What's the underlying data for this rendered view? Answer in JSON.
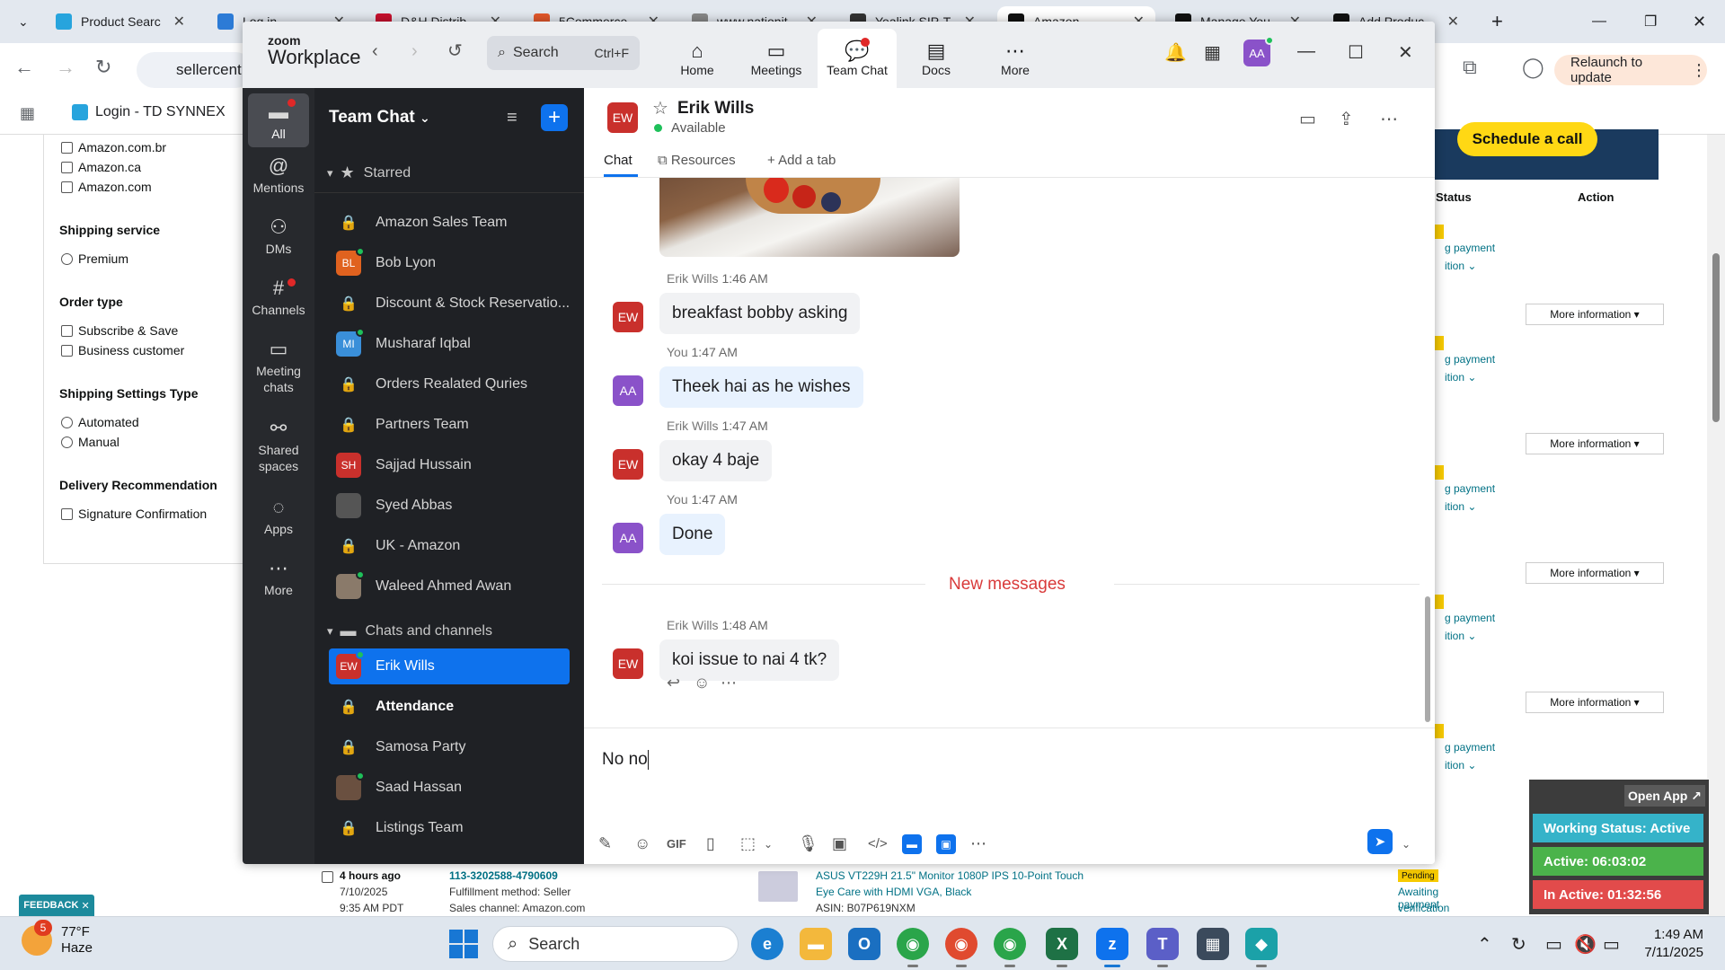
{
  "browser": {
    "tabs": [
      {
        "label": "Product Searc",
        "active": false
      },
      {
        "label": "Log in",
        "active": false
      },
      {
        "label": "D&H Distrib",
        "active": false
      },
      {
        "label": "5Commerce",
        "active": false
      },
      {
        "label": "www.nationit",
        "active": false
      },
      {
        "label": "Yealink SIP-T",
        "active": false
      },
      {
        "label": "Amazon",
        "active": true
      },
      {
        "label": "Manage You",
        "active": false
      },
      {
        "label": "Add Produc",
        "active": false
      }
    ],
    "address": "sellercent",
    "relaunch_label": "Relaunch to update",
    "bookmark_label": "Login - TD SYNNEX"
  },
  "page": {
    "filters": {
      "marketplaces": [
        "Amazon.com.br",
        "Amazon.ca",
        "Amazon.com"
      ],
      "shipping_service_heading": "Shipping service",
      "shipping_service_options": [
        "Premium"
      ],
      "order_type_heading": "Order type",
      "order_type_options": [
        "Subscribe & Save",
        "Business customer"
      ],
      "shipping_settings_heading": "Shipping Settings Type",
      "shipping_settings_options": [
        "Automated",
        "Manual"
      ],
      "delivery_heading": "Delivery Recommendation",
      "delivery_options": [
        "Signature Confirmation"
      ]
    },
    "schedule_button": "Schedule a call",
    "col_status": "Status",
    "col_action": "Action",
    "awaiting_text": "g payment",
    "verification_text": "ition",
    "more_info": "More information",
    "order": {
      "age": "4 hours ago",
      "date": "7/10/2025",
      "time": "9:35 AM PDT",
      "order_id": "113-3202588-4790609",
      "fulfillment": "Fulfillment method: Seller",
      "channel": "Sales channel: Amazon.com",
      "product_line1": "ASUS VT229H 21.5\" Monitor 1080P IPS 10-Point Touch",
      "product_line2": "Eye Care with HDMI VGA, Black",
      "asin": "ASIN: B07P619NXM",
      "status_badge": "Pending",
      "status_line1": "Awaiting payment",
      "status_line2": "verification"
    },
    "feedback_label": "FEEDBACK"
  },
  "widget": {
    "open_app": "Open App",
    "working_status": "Working Status: Active",
    "active_time": "Active: 06:03:02",
    "inactive_time": "In Active: 01:32:56",
    "colors": {
      "status": "#35b3c9",
      "active": "#4bb34b",
      "inactive": "#e24b4b"
    }
  },
  "zoom": {
    "brand_top": "zoom",
    "brand_bottom": "Workplace",
    "search_label": "Search",
    "search_shortcut": "Ctrl+F",
    "nav": [
      {
        "label": "Home",
        "icon": "home-icon"
      },
      {
        "label": "Meetings",
        "icon": "video-icon"
      },
      {
        "label": "Team Chat",
        "icon": "chat-icon",
        "selected": true
      },
      {
        "label": "Docs",
        "icon": "docs-icon"
      },
      {
        "label": "More",
        "icon": "more-icon"
      }
    ],
    "user_initials": "AA",
    "rail": [
      {
        "label": "All",
        "selected": true
      },
      {
        "label": "Mentions"
      },
      {
        "label": "DMs"
      },
      {
        "label": "Channels"
      },
      {
        "label": "Meeting chats"
      },
      {
        "label": "Shared spaces"
      },
      {
        "label": "Apps"
      },
      {
        "label": "More"
      }
    ],
    "list_title": "Team Chat",
    "starred_label": "Starred",
    "starred": [
      {
        "name": "Amazon Sales Team",
        "type": "lock"
      },
      {
        "name": "Bob Lyon",
        "type": "avatar",
        "initials": "BL",
        "color": "#e0621f",
        "online": true
      },
      {
        "name": "Discount & Stock Reservatio...",
        "type": "lock"
      },
      {
        "name": "Musharaf Iqbal",
        "type": "avatar",
        "initials": "MI",
        "color": "#3a8fd9",
        "online": true
      },
      {
        "name": "Orders Realated Quries",
        "type": "lock"
      },
      {
        "name": "Partners Team",
        "type": "lock"
      },
      {
        "name": "Sajjad Hussain",
        "type": "avatar",
        "initials": "SH",
        "color": "#c9302c",
        "online": false
      },
      {
        "name": "Syed Abbas",
        "type": "photo",
        "color": "#555555",
        "online": false
      },
      {
        "name": "UK - Amazon",
        "type": "lock"
      },
      {
        "name": "Waleed Ahmed Awan",
        "type": "photo",
        "color": "#8a7a6a",
        "online": true
      }
    ],
    "chats_label": "Chats and channels",
    "chats": [
      {
        "name": "Erik Wills",
        "type": "avatar",
        "initials": "EW",
        "color": "#c9302c",
        "online": true,
        "selected": true
      },
      {
        "name": "Attendance",
        "type": "lock",
        "bold": true
      },
      {
        "name": "Samosa Party",
        "type": "lock"
      },
      {
        "name": "Saad Hassan",
        "type": "photo",
        "color": "#6a5040",
        "online": true
      },
      {
        "name": "Listings Team",
        "type": "lock"
      }
    ],
    "conversation": {
      "initials": "EW",
      "name": "Erik Wills",
      "status": "Available",
      "tabs": [
        "Chat",
        "Resources",
        "Add a tab"
      ],
      "messages": [
        {
          "sender": "Erik Wills",
          "time": "1:46 AM",
          "text": "breakfast bobby asking",
          "initials": "EW",
          "mine": false
        },
        {
          "sender": "You",
          "time": "1:47 AM",
          "text": "Theek hai as he wishes",
          "initials": "AA",
          "mine": true
        },
        {
          "sender": "Erik Wills",
          "time": "1:47 AM",
          "text": "okay 4 baje",
          "initials": "EW",
          "mine": false
        },
        {
          "sender": "You",
          "time": "1:47 AM",
          "text": "Done",
          "initials": "AA",
          "mine": true
        },
        {
          "sender": "Erik Wills",
          "time": "1:48 AM",
          "text": "koi issue to nai 4 tk?",
          "initials": "EW",
          "mine": false
        }
      ],
      "new_messages_label": "New messages",
      "draft": "No no"
    }
  },
  "taskbar": {
    "temperature": "77°F",
    "weather": "Haze",
    "weather_badge": "5",
    "search_label": "Search",
    "time": "1:49 AM",
    "date": "7/11/2025"
  }
}
